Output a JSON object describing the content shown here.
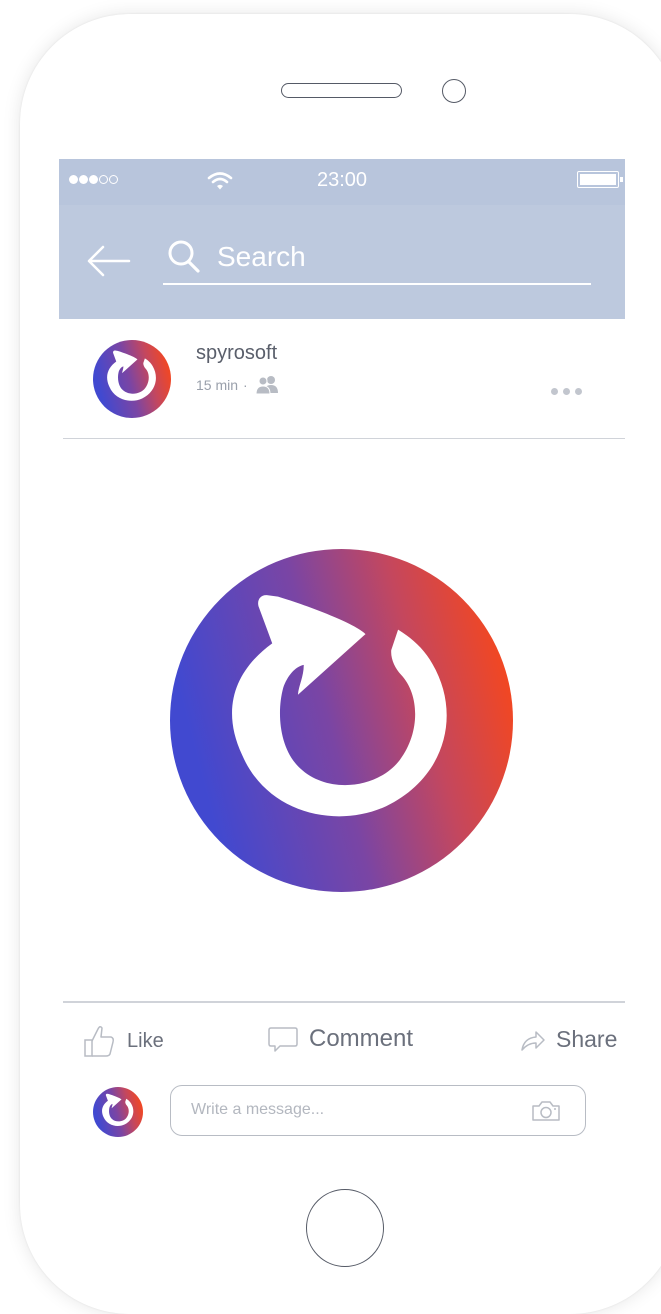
{
  "status_bar": {
    "time": "23:00",
    "signal_dots": [
      "filled",
      "filled",
      "filled",
      "empty",
      "empty"
    ]
  },
  "nav": {
    "search_placeholder": "Search"
  },
  "post": {
    "username": "spyrosoft",
    "time_ago": "15 min",
    "separator": "·"
  },
  "actions": {
    "like_label": "Like",
    "comment_label": "Comment",
    "share_label": "Share"
  },
  "composer": {
    "placeholder": "Write a message..."
  },
  "icons": {
    "back": "arrow-left-icon",
    "search": "search-icon",
    "audience": "friends-icon",
    "more": "more-dots-icon",
    "like": "thumbs-up-icon",
    "comment": "speech-bubble-icon",
    "share": "share-arrow-icon",
    "camera": "camera-icon"
  },
  "colors": {
    "header_bg": "#bdc9de",
    "brand_gradient_start": "#4149d0",
    "brand_gradient_end": "#f4471f"
  }
}
